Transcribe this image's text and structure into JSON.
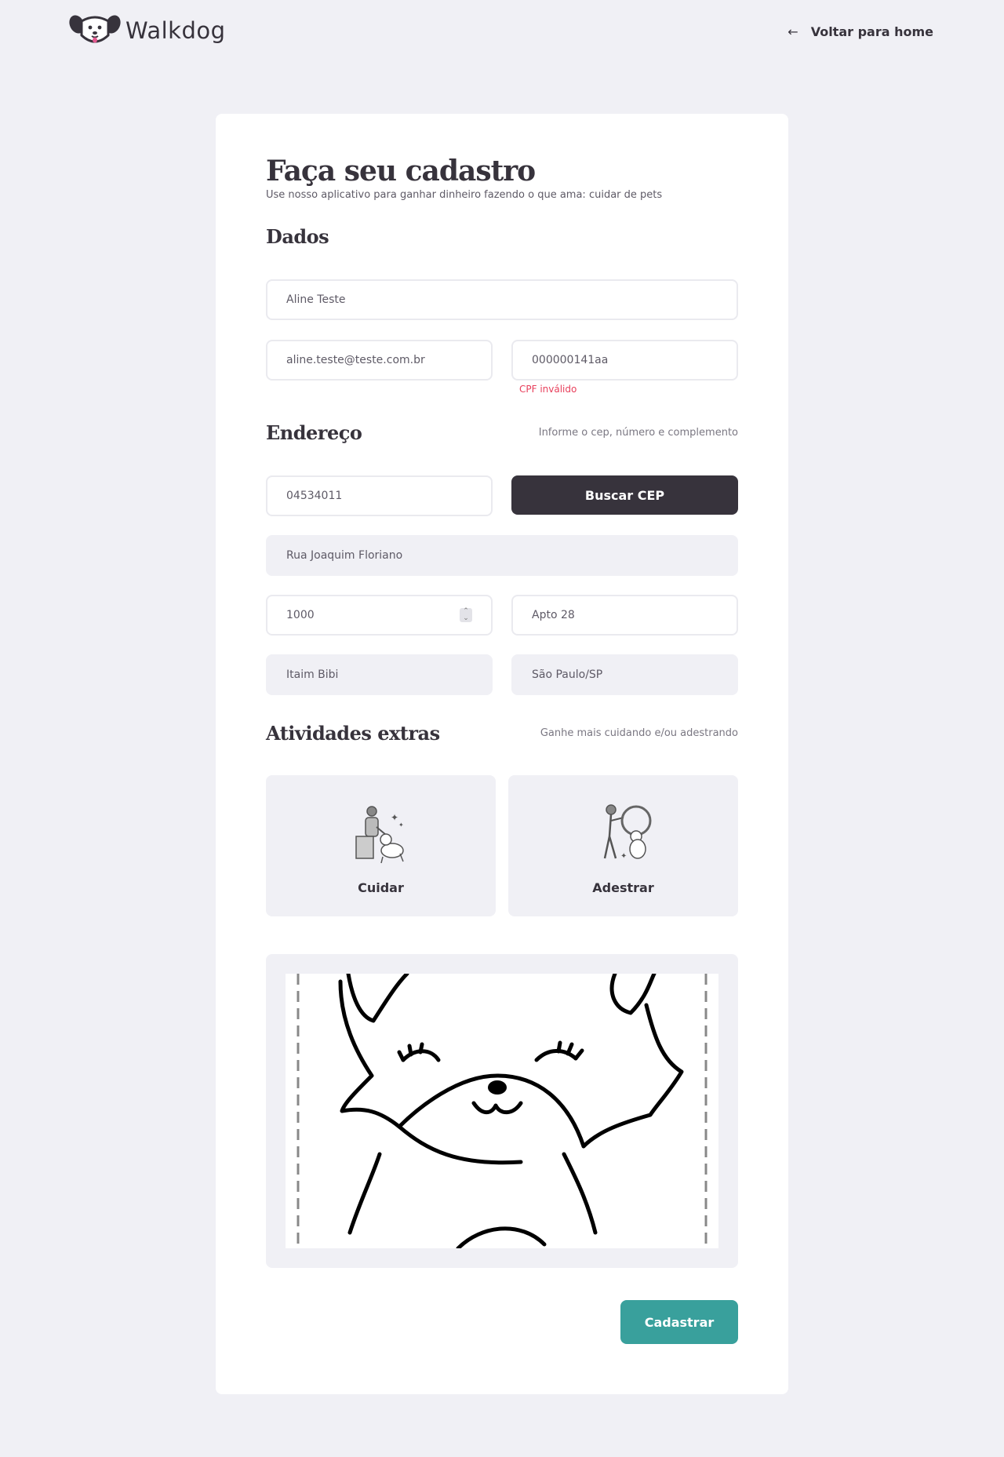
{
  "header": {
    "brand": "Walkdog",
    "back_link": "Voltar para home"
  },
  "form": {
    "title": "Faça seu cadastro",
    "subtitle": "Use nosso aplicativo para ganhar dinheiro fazendo o que ama: cuidar de pets",
    "dados": {
      "heading": "Dados",
      "name_value": "Aline Teste",
      "email_value": "aline.teste@teste.com.br",
      "cpf_value": "000000141aa",
      "cpf_error": "CPF inválido"
    },
    "endereco": {
      "heading": "Endereço",
      "hint": "Informe o cep, número e complemento",
      "cep_value": "04534011",
      "buscar_cep_label": "Buscar CEP",
      "street_value": "Rua Joaquim Floriano",
      "number_value": "1000",
      "complement_value": "Apto 28",
      "district_value": "Itaim Bibi",
      "city_value": "São Paulo/SP"
    },
    "atividades": {
      "heading": "Atividades extras",
      "hint": "Ganhe mais cuidando e/ou adestrando",
      "options": [
        {
          "label": "Cuidar",
          "icon": "pet-care-icon"
        },
        {
          "label": "Adestrar",
          "icon": "dog-training-icon"
        }
      ]
    },
    "submit_label": "Cadastrar"
  },
  "colors": {
    "background": "#f0f0f5",
    "dark": "#37333c",
    "primary": "#39a09c",
    "error": "#e83f5b"
  }
}
